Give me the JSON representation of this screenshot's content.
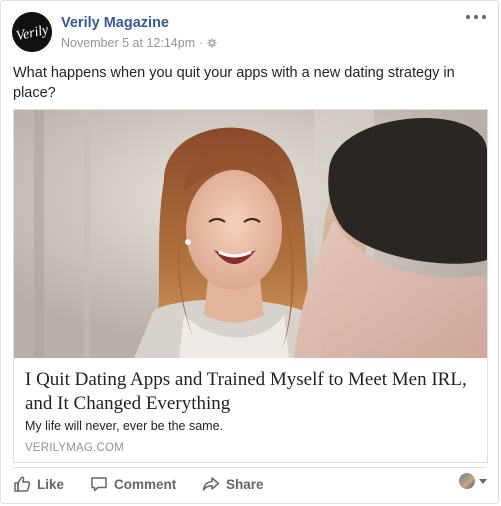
{
  "post": {
    "page_name": "Verily Magazine",
    "avatar_logo_text": "Verily",
    "timestamp": "November 5 at 12:14pm",
    "separator": "·",
    "audience_icon": "settings-gear-icon",
    "text": "What happens when you quit your apps with a new dating strategy in place?",
    "more_icon": "more-options-icon"
  },
  "link_card": {
    "image_alt": "Smiling woman with long wavy hair laughing, man seen from behind in foreground",
    "title": "I Quit Dating Apps and Trained Myself to Meet Men IRL, and It Changed Everything",
    "description": "My life will never, ever be the same.",
    "domain": "VERILYMAG.COM"
  },
  "actions": {
    "like_label": "Like",
    "comment_label": "Comment",
    "share_label": "Share",
    "like_icon": "thumbs-up-icon",
    "comment_icon": "speech-bubble-icon",
    "share_icon": "share-arrow-icon"
  },
  "colors": {
    "page_name": "#385898",
    "meta": "#90949c",
    "action_text": "#606770",
    "border": "#dddfe2"
  }
}
